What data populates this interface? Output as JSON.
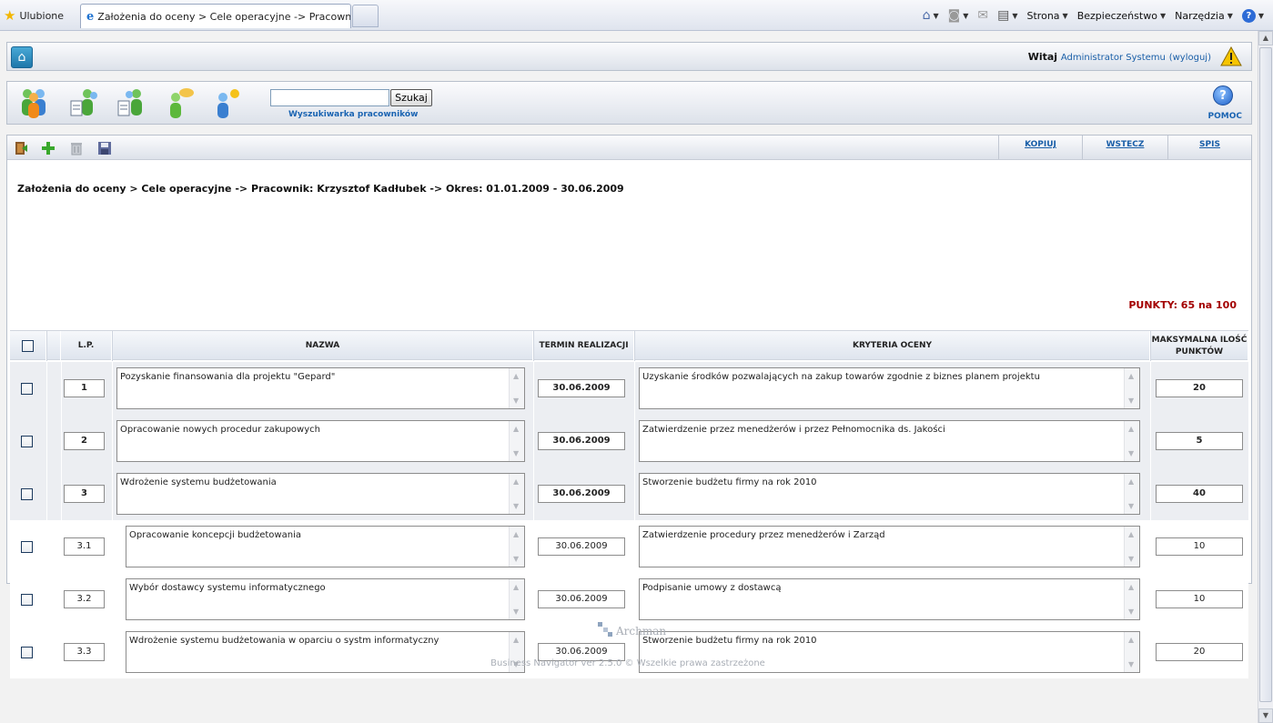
{
  "browser": {
    "favorites_label": "Ulubione",
    "tab_title": "Założenia do oceny > Cele operacyjne -> Pracownik: ...",
    "menu": {
      "page": "Strona",
      "security": "Bezpieczeństwo",
      "tools": "Narzędzia"
    }
  },
  "header": {
    "greeting": "Witaj",
    "user": "Administrator Systemu",
    "logout": "wyloguj",
    "open_paren": "(",
    "close_paren": ")"
  },
  "toolbar": {
    "search_placeholder": "",
    "search_button": "Szukaj",
    "search_caption": "Wyszukiwarka pracowników",
    "help_label": "POMOC"
  },
  "actions": {
    "copy": "KOPIUJ",
    "back": "WSTECZ",
    "list": "SPIS"
  },
  "breadcrumb": "Założenia do oceny > Cele operacyjne -> Pracownik: Krzysztof Kadłubek -> Okres: 01.01.2009 - 30.06.2009",
  "points_summary": "PUNKTY: 65 na 100",
  "table": {
    "headers": {
      "lp": "L.P.",
      "name": "NAZWA",
      "deadline": "TERMIN REALIZACJI",
      "criteria": "KRYTERIA OCENY",
      "max_points": "MAKSYMALNA ILOŚĆ PUNKTÓW"
    },
    "rows": [
      {
        "lp": "1",
        "name": "Pozyskanie finansowania dla projektu \"Gepard\"",
        "deadline": "30.06.2009",
        "criteria": "Uzyskanie środków pozwalających na zakup towarów zgodnie z biznes planem projektu",
        "points": "20"
      },
      {
        "lp": "2",
        "name": "Opracowanie nowych procedur zakupowych",
        "deadline": "30.06.2009",
        "criteria": "Zatwierdzenie przez menedżerów i przez Pełnomocnika ds. Jakości",
        "points": "5"
      },
      {
        "lp": "3",
        "name": "Wdrożenie systemu budżetowania",
        "deadline": "30.06.2009",
        "criteria": "Stworzenie budżetu firmy na rok 2010",
        "points": "40"
      },
      {
        "lp": "3.1",
        "name": "Opracowanie koncepcji budżetowania",
        "deadline": "30.06.2009",
        "criteria": "Zatwierdzenie procedury przez menedżerów i Zarząd",
        "points": "10"
      },
      {
        "lp": "3.2",
        "name": "Wybór dostawcy systemu informatycznego",
        "deadline": "30.06.2009",
        "criteria": "Podpisanie umowy z dostawcą",
        "points": "10"
      },
      {
        "lp": "3.3",
        "name": "Wdrożenie systemu budżetowania w oparciu o systm informatyczny",
        "deadline": "30.06.2009",
        "criteria": "Stworzenie budżetu firmy na rok 2010",
        "points": "20"
      }
    ]
  },
  "footer": {
    "logo_text": "Archman",
    "copyright": "Business Navigator ver 2.5.0 © Wszelkie prawa zastrzeżone"
  }
}
